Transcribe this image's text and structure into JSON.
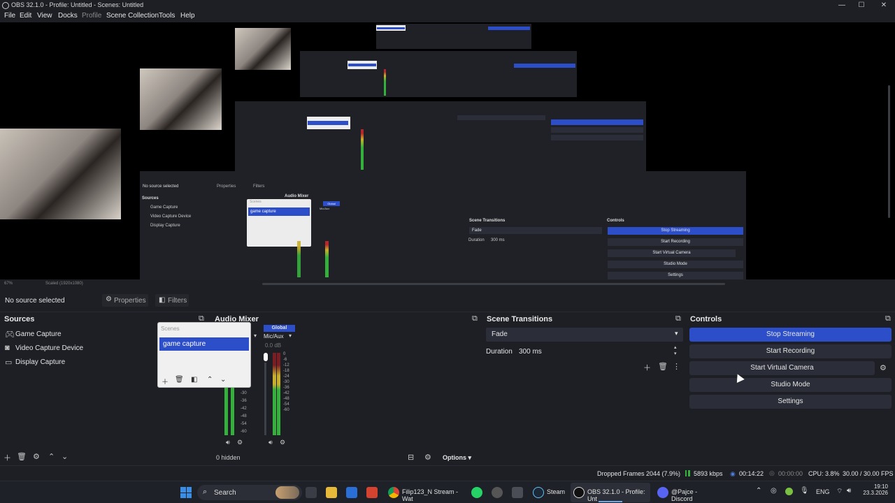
{
  "window": {
    "title": "OBS 32.1.0 - Profile: Untitled - Scenes: Untitled",
    "controls": [
      "—",
      "☐",
      "✕"
    ]
  },
  "menu": [
    "File",
    "Edit",
    "View",
    "Docks",
    "Profile",
    "Scene Collection",
    "Tools",
    "Help"
  ],
  "preview": {
    "zoom": "67%",
    "scale": "Scaled (1920x1080)",
    "nested_sources": [
      "Game Capture",
      "Video Capture Device",
      "Display Capture"
    ],
    "nested_status": "No source selected",
    "nested_transition": "Fade",
    "nested_duration": "300 ms",
    "nested_controls": [
      "Stop Streaming",
      "Start Recording",
      "Start Virtual Camera",
      "Studio Mode",
      "Settings"
    ],
    "nested_docks": [
      "Sources",
      "Audio Mixer",
      "Scene Transitions",
      "Controls"
    ],
    "nested_tabs": [
      "Properties",
      "Filters"
    ],
    "nested_scene": "game capture",
    "nested_scene_header": "Scenes",
    "nested_global": "Global",
    "nested_mic": "Mic/Aux",
    "nested_duration_label": "Duration"
  },
  "propbar": {
    "status": "No source selected",
    "properties": "Properties",
    "filters": "Filters"
  },
  "sources": {
    "title": "Sources",
    "items": [
      "Game Capture",
      "Video Capture Device",
      "Display Capture"
    ]
  },
  "scenes_popup": {
    "header": "Scenes",
    "selected": "game capture"
  },
  "mixer": {
    "title": "Audio Mixer",
    "global": "Global",
    "mic": "Mic/Aux",
    "db": "0.0 dB",
    "scale": [
      "0",
      "-6",
      "-12",
      "-18",
      "-24",
      "-30",
      "-36",
      "-42",
      "-48",
      "-54",
      "-60"
    ],
    "scale_left": [
      "-30",
      "-36",
      "-42",
      "-48",
      "-54",
      "-60"
    ],
    "hidden": "0 hidden",
    "options": "Options"
  },
  "transitions": {
    "title": "Scene Transitions",
    "selected": "Fade",
    "duration_label": "Duration",
    "duration": "300 ms"
  },
  "controls": {
    "title": "Controls",
    "stop_streaming": "Stop Streaming",
    "start_recording": "Start Recording",
    "start_virtual_camera": "Start Virtual Camera",
    "studio_mode": "Studio Mode",
    "settings": "Settings"
  },
  "statusbar": {
    "dropped": "Dropped Frames 2044 (7.9%)",
    "bitrate": "5893 kbps",
    "stream_time": "00:14:22",
    "rec_time": "00:00:00",
    "cpu": "CPU: 3.8%",
    "fps": "30.00 / 30.00 FPS"
  },
  "taskbar": {
    "search": "Search",
    "items": [
      "Filip123_N Stream - Wat",
      "Steam",
      "OBS 32.1.0 - Profile: Unt",
      "@Pajce - Discord"
    ],
    "lang": "ENG",
    "time": "19:10",
    "date": "23.3.2026"
  },
  "colors": {
    "accent": "#2c4ec9",
    "bg": "#1d1f24",
    "button": "#2b2e38",
    "meter_green": "#35b03d",
    "meter_yellow": "#c9b02a",
    "meter_red": "#b3272d"
  }
}
